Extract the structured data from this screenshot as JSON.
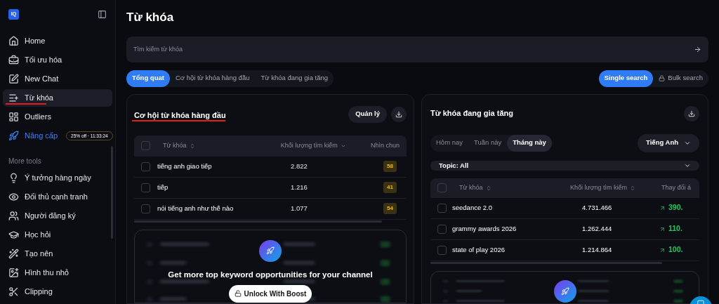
{
  "sidebar": {
    "logo": "IQ",
    "items": [
      {
        "kind": "nav",
        "label": "Home",
        "selected": false
      },
      {
        "kind": "nav",
        "label": "Tối ưu hóa",
        "selected": false
      },
      {
        "kind": "nav",
        "label": "New Chat",
        "selected": false
      },
      {
        "kind": "nav",
        "label": "Từ khóa",
        "selected": true
      },
      {
        "kind": "nav",
        "label": "Outliers",
        "selected": false
      },
      {
        "kind": "upgrade",
        "label": "Nâng cấp",
        "badge": "25% off · 11:33:24",
        "selected": false
      }
    ],
    "section_label": "More tools",
    "tools": [
      {
        "label": "Ý tưởng hàng ngày"
      },
      {
        "label": "Đối thủ cạnh tranh"
      },
      {
        "label": "Người đăng ký"
      },
      {
        "label": "Học hỏi"
      },
      {
        "label": "Tạo nên"
      },
      {
        "label": "Hình thu nhỏ"
      },
      {
        "label": "Clipping"
      }
    ]
  },
  "page_title": "Từ khóa",
  "search": {
    "placeholder": "Tìm kiếm từ khóa"
  },
  "tabs": [
    {
      "label": "Tổng quat",
      "selected": true
    },
    {
      "label": "Cơ hội từ khóa hàng đầu",
      "selected": false
    },
    {
      "label": "Từ khóa đang gia tăng",
      "selected": false
    }
  ],
  "search_modes": [
    {
      "label": "Single search",
      "selected": true,
      "locked": false
    },
    {
      "label": "Bulk search",
      "selected": false,
      "locked": true
    }
  ],
  "top_card": {
    "title": "Cơ hội từ khóa hàng đầu",
    "manage_button": "Quản lý",
    "columns": [
      "Từ khóa",
      "Khối lượng tìm kiếm",
      "Nhìn chun"
    ],
    "all_checked": false,
    "rows": [
      {
        "keyword": "tiếng anh giao tiếp",
        "volume": "2.822",
        "score": "58",
        "checked": false
      },
      {
        "keyword": "tiếp",
        "volume": "1.216",
        "score": "41",
        "checked": false
      },
      {
        "keyword": "nói tiếng anh như thế nào",
        "volume": "1.077",
        "score": "54",
        "checked": false
      }
    ],
    "locked": {
      "message": "Get more top keyword opportunities for your channel",
      "button": "Unlock With Boost"
    }
  },
  "rising_card": {
    "title": "Từ khóa đang gia tăng",
    "periods": [
      {
        "label": "Hôm nay",
        "selected": false
      },
      {
        "label": "Tuần này",
        "selected": false
      },
      {
        "label": "Tháng này",
        "selected": true
      }
    ],
    "language": "Tiếng Anh",
    "topic": "Topic: All",
    "columns": [
      "Từ khóa",
      "Khối lượng tìm kiếm",
      "Thay đổi á"
    ],
    "all_checked": false,
    "rows": [
      {
        "keyword": "seedance 2.0",
        "volume": "4.731.466",
        "change": "390.",
        "checked": false
      },
      {
        "keyword": "grammy awards 2026",
        "volume": "1.262.444",
        "change": "110.",
        "checked": false
      },
      {
        "keyword": "state of play 2026",
        "volume": "1.214.864",
        "change": "100.",
        "checked": false
      }
    ]
  }
}
